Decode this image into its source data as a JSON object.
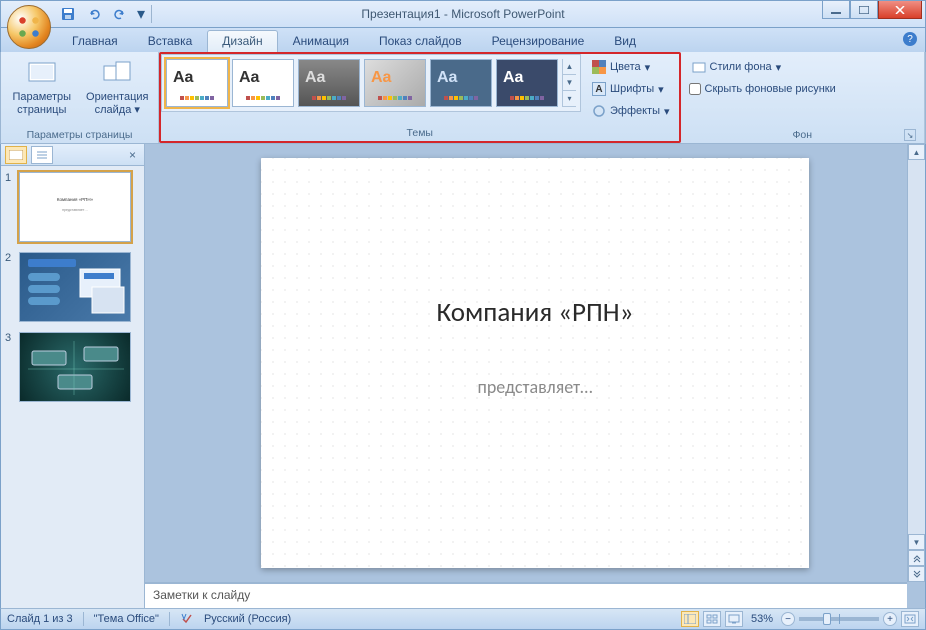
{
  "window": {
    "title": "Презентация1 - Microsoft PowerPoint"
  },
  "tabs": {
    "home": "Главная",
    "insert": "Вставка",
    "design": "Дизайн",
    "animations": "Анимация",
    "slideshow": "Показ слайдов",
    "review": "Рецензирование",
    "view": "Вид"
  },
  "ribbon": {
    "page_setup": {
      "group_label": "Параметры страницы",
      "page_params": "Параметры страницы",
      "orientation": "Ориентация слайда"
    },
    "themes": {
      "group_label": "Темы",
      "colors": "Цвета",
      "fonts": "Шрифты",
      "effects": "Эффекты"
    },
    "background": {
      "group_label": "Фон",
      "styles": "Стили фона",
      "hide_graphics": "Скрыть фоновые рисунки"
    }
  },
  "slide": {
    "title": "Компания «РПН»",
    "subtitle": "представляет…"
  },
  "thumbs": {
    "n1": "1",
    "n2": "2",
    "n3": "3"
  },
  "notes": {
    "placeholder": "Заметки к слайду"
  },
  "status": {
    "slide_count": "Слайд 1 из 3",
    "theme": "\"Тема Office\"",
    "language": "Русский (Россия)",
    "zoom": "53%"
  }
}
